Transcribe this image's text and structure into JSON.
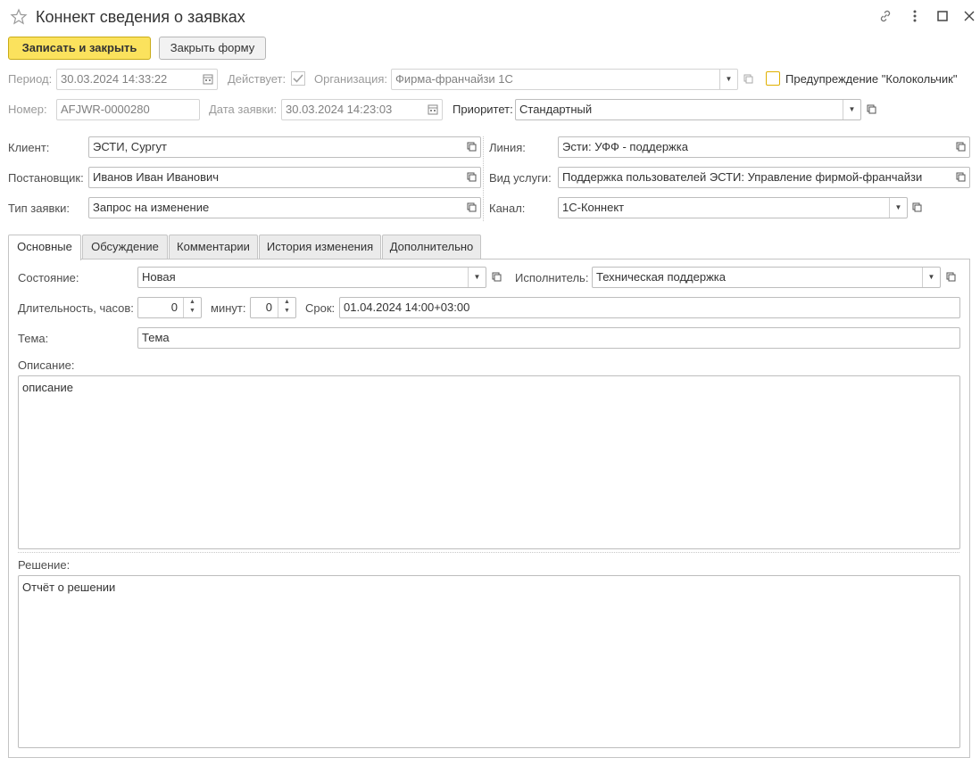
{
  "window": {
    "title": "Коннект сведения о заявках",
    "icons": [
      "star-icon",
      "link-icon",
      "more-icon",
      "maximize-icon",
      "close-icon"
    ]
  },
  "toolbar": {
    "save_close": "Записать и закрыть",
    "close_form": "Закрыть форму"
  },
  "header": {
    "period_label": "Период:",
    "period_value": "30.03.2024 14:33:22",
    "active_label": "Действует:",
    "active_checked": true,
    "org_label": "Организация:",
    "org_value": "Фирма-франчайзи 1С",
    "bell_label": "Предупреждение \"Колокольчик\"",
    "number_label": "Номер:",
    "number_value": "AFJWR-0000280",
    "date_label": "Дата заявки:",
    "date_value": "30.03.2024 14:23:03",
    "priority_label": "Приоритет:",
    "priority_value": "Стандартный"
  },
  "info": {
    "client_label": "Клиент:",
    "client_value": "ЭСТИ, Сургут",
    "author_label": "Постановщик:",
    "author_value": "Иванов Иван Иванович",
    "type_label": "Тип заявки:",
    "type_value": "Запрос на изменение",
    "line_label": "Линия:",
    "line_value": "Эсти: УФФ - поддержка",
    "service_label": "Вид услуги:",
    "service_value": "Поддержка пользователей ЭСТИ: Управление фирмой-франчайзи",
    "channel_label": "Канал:",
    "channel_value": "1С-Коннект"
  },
  "tabs": [
    "Основные",
    "Обсуждение",
    "Комментарии",
    "История изменения",
    "Дополнительно"
  ],
  "main": {
    "state_label": "Состояние:",
    "state_value": "Новая",
    "executor_label": "Исполнитель:",
    "executor_value": "Техническая поддержка",
    "duration_label": "Длительность, часов:",
    "hours_value": "0",
    "minutes_label": "минут:",
    "minutes_value": "0",
    "deadline_label": "Срок:",
    "deadline_value": "01.04.2024 14:00+03:00",
    "topic_label": "Тема:",
    "topic_value": "Тема",
    "description_label": "Описание:",
    "description_value": "описание",
    "solution_label": "Решение:",
    "solution_value": "Отчёт о решении"
  },
  "colors": {
    "primary_button": "#fbe25d",
    "bell_checkbox_border": "#e0b000"
  }
}
